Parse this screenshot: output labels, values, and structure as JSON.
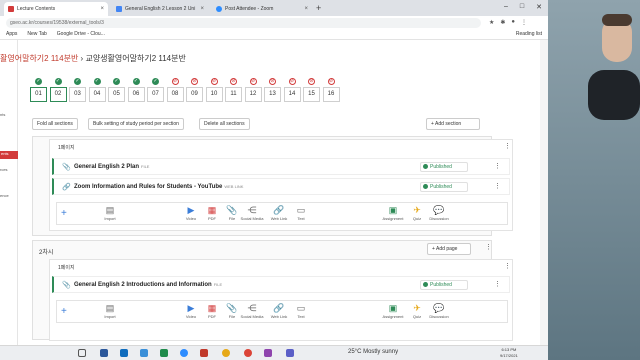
{
  "browser": {
    "tabs": [
      {
        "title": "Lecture Contents",
        "color": "#d23b3b"
      },
      {
        "title": "General English 2 Lesson 2 Uni",
        "color": "#4285f4"
      },
      {
        "title": "Post Attendee - Zoom",
        "color": "#2d8cff"
      }
    ],
    "new_tab": "+",
    "url": "gseo.ac.kr/courses/19538/external_tools/3",
    "window_controls": [
      "–",
      "□",
      "✕"
    ],
    "bookmarks": [
      "Apps",
      "New Tab",
      "Google Drive - Clou...",
      "Reading list"
    ]
  },
  "left_nav": {
    "items": [
      {
        "label": "nts",
        "active": false
      },
      {
        "label": "ents",
        "active": true
      },
      {
        "label": "rces",
        "active": false
      },
      {
        "label": "ence",
        "active": false
      }
    ]
  },
  "breadcrumb": {
    "course": "활영어말하기2 114분반",
    "separator": "›",
    "current": "교양생활영어말하기2 114분반"
  },
  "weeks": [
    {
      "num": "01",
      "status": "done",
      "selected": true
    },
    {
      "num": "02",
      "status": "done",
      "selected": true
    },
    {
      "num": "03",
      "status": "done",
      "selected": false
    },
    {
      "num": "04",
      "status": "done",
      "selected": false
    },
    {
      "num": "05",
      "status": "done",
      "selected": false
    },
    {
      "num": "06",
      "status": "done",
      "selected": false
    },
    {
      "num": "07",
      "status": "done",
      "selected": false
    },
    {
      "num": "08",
      "status": "none",
      "selected": false
    },
    {
      "num": "09",
      "status": "none",
      "selected": false
    },
    {
      "num": "10",
      "status": "none",
      "selected": false
    },
    {
      "num": "11",
      "status": "none",
      "selected": false
    },
    {
      "num": "12",
      "status": "none",
      "selected": false
    },
    {
      "num": "13",
      "status": "none",
      "selected": false
    },
    {
      "num": "14",
      "status": "none",
      "selected": false
    },
    {
      "num": "15",
      "status": "none",
      "selected": false
    },
    {
      "num": "16",
      "status": "none",
      "selected": false
    }
  ],
  "toolbar": {
    "fold": "Fold all sections",
    "bulk": "Bulk setting of study period per section",
    "delete": "Delete all sections",
    "add_section": "+ Add section"
  },
  "section1": {
    "subheading": "1페이지",
    "items": [
      {
        "title": "General English 2 Plan",
        "type": "FILE",
        "status": "Published"
      },
      {
        "title": "Zoom Information and Rules for Students - YouTube",
        "type": "WEB LINK",
        "status": "Published"
      }
    ]
  },
  "section2": {
    "heading": "2차시",
    "add_page": "+ Add page",
    "subheading": "1페이지",
    "items": [
      {
        "title": "General English 2 Introductions and Information",
        "type": "FILE",
        "status": "Published"
      }
    ]
  },
  "add_tools": [
    {
      "label": "Import",
      "icon": "import-icon"
    },
    {
      "label": "Video",
      "icon": "video-icon"
    },
    {
      "label": "PDF",
      "icon": "pdf-icon"
    },
    {
      "label": "File",
      "icon": "file-icon"
    },
    {
      "label": "Social Media",
      "icon": "share-icon"
    },
    {
      "label": "Web Link",
      "icon": "link-icon"
    },
    {
      "label": "Text",
      "icon": "text-icon"
    },
    {
      "label": "Assignment",
      "icon": "assignment-icon"
    },
    {
      "label": "Quiz",
      "icon": "quiz-icon"
    },
    {
      "label": "Discussion",
      "icon": "discussion-icon"
    }
  ],
  "taskbar": {
    "weather": "25°C  Mostly sunny",
    "time": "6:13 PM",
    "date": "9/17/2021"
  },
  "colors": {
    "accent": "#d23b3b",
    "published": "#2e8b57",
    "link": "#3b7dd8"
  }
}
